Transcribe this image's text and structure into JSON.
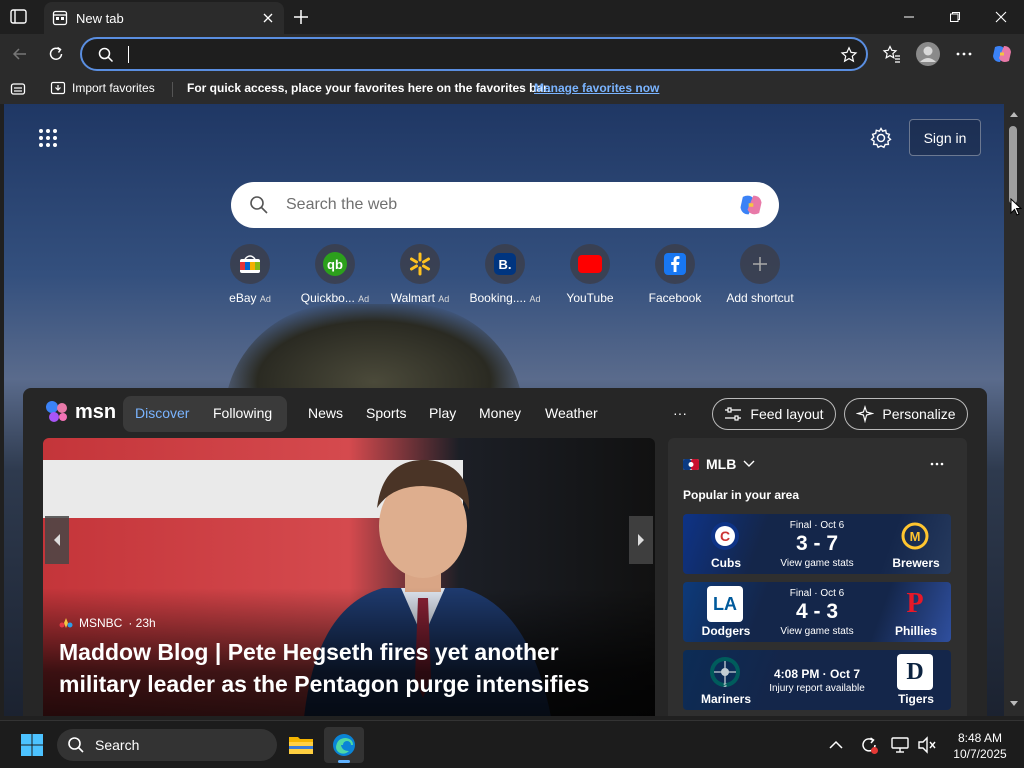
{
  "browser": {
    "tab_title": "New tab",
    "address_value": ""
  },
  "favorites_bar": {
    "import_label": "Import favorites",
    "hint": "For quick access, place your favorites here on the favorites bar.",
    "manage_link": "Manage favorites now"
  },
  "newtab": {
    "sign_in": "Sign in",
    "search_placeholder": "Search the web",
    "shortcuts": [
      {
        "name": "eBay",
        "ad": "Ad"
      },
      {
        "name": "Quickbo...",
        "ad": "Ad"
      },
      {
        "name": "Walmart",
        "ad": "Ad"
      },
      {
        "name": "Booking....",
        "ad": "Ad"
      },
      {
        "name": "YouTube",
        "ad": ""
      },
      {
        "name": "Facebook",
        "ad": ""
      },
      {
        "name": "Add shortcut",
        "ad": ""
      }
    ]
  },
  "feed": {
    "brand": "msn",
    "tabs": [
      "Discover",
      "Following"
    ],
    "nav": [
      "News",
      "Sports",
      "Play",
      "Money",
      "Weather"
    ],
    "more": "···",
    "feed_layout": "Feed layout",
    "personalize": "Personalize",
    "hero": {
      "source": "MSNBC",
      "age": "· 23h",
      "headline": "Maddow Blog | Pete Hegseth fires yet another military leader as the Pentagon purge intensifies"
    },
    "mlb": {
      "title": "MLB",
      "subtitle": "Popular in your area",
      "games": [
        {
          "home": "Cubs",
          "away": "Brewers",
          "status": "Final · Oct 6",
          "score": "3 - 7",
          "link": "View game stats",
          "home_abbr": "C",
          "away_abbr": "M"
        },
        {
          "home": "Dodgers",
          "away": "Phillies",
          "status": "Final · Oct 6",
          "score": "4 - 3",
          "link": "View game stats",
          "home_abbr": "LA",
          "away_abbr": "P"
        },
        {
          "home": "Mariners",
          "away": "Tigers",
          "time": "4:08 PM · Oct 7",
          "note": "Injury report available",
          "home_abbr": "S",
          "away_abbr": "D"
        }
      ]
    }
  },
  "taskbar": {
    "search_label": "Search",
    "time": "8:48 AM",
    "date": "10/7/2025"
  },
  "colors": {
    "accent": "#5a8ee0",
    "link": "#7ab4ff",
    "feed_bg": "#262626"
  }
}
